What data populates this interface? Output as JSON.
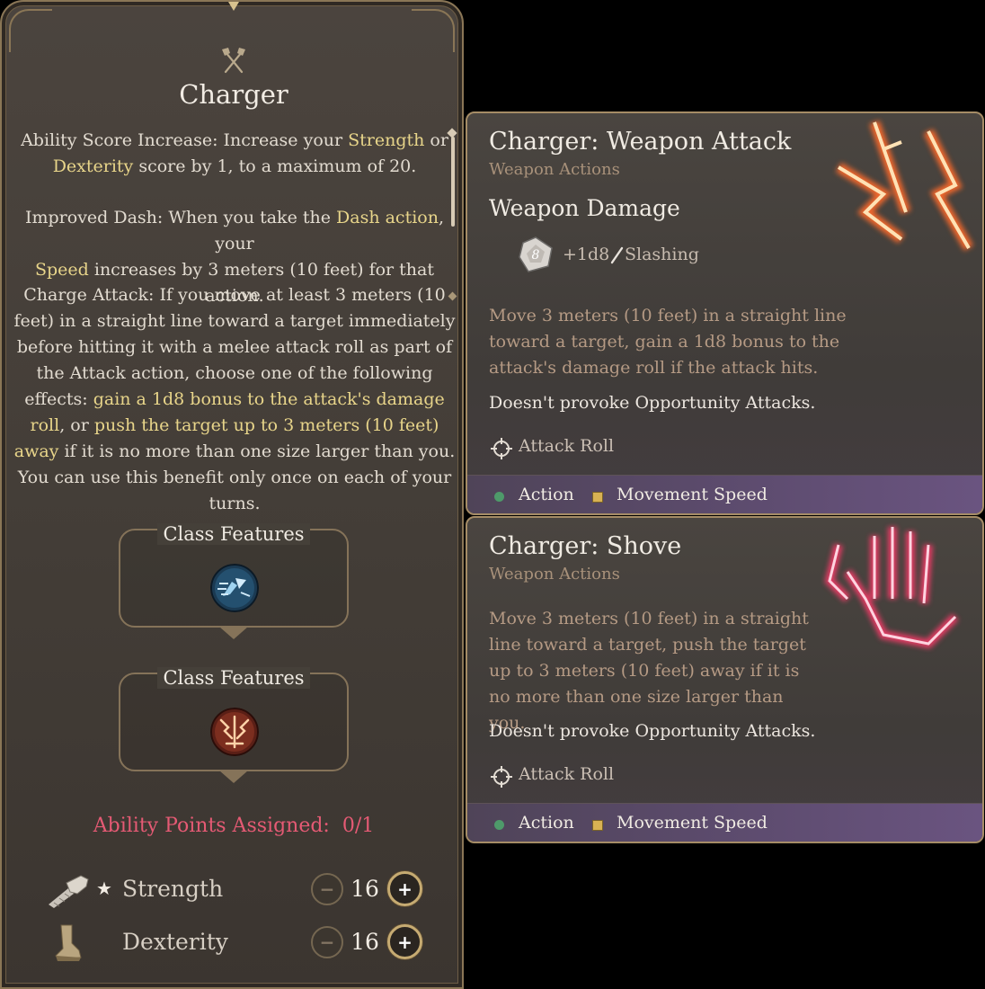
{
  "feat": {
    "icon": "crossed-axes-icon",
    "title": "Charger",
    "p1": {
      "t1": "Ability Score Increase: Increase your ",
      "h1": "Strength",
      "t2": " or",
      "h2": "Dexterity",
      "t3": " score by 1, to a maximum of 20."
    },
    "p2": {
      "t1": "Improved Dash: When you take the ",
      "h1": "Dash action",
      "t2": ", your",
      "h2": "Speed",
      "t3": " increases by 3 meters (10 feet) for that action."
    },
    "p3": {
      "t1": "Charge Attack: If you move at least 3 meters (10 feet) in a straight line toward a target immediately before hitting it with a melee attack roll as part of the Attack action, choose one of the following effects: ",
      "h1": "gain a 1d8 bonus to the attack's damage roll",
      "t2": ", or ",
      "h2": "push the target up to 3 meters (10 feet) away",
      "t3": " if it is no more than one size larger than you. You can use this benefit only once on each of your turns."
    },
    "class_features": [
      {
        "title": "Class Features",
        "icon": "charger-dash-icon"
      },
      {
        "title": "Class Features",
        "icon": "charger-burst-icon"
      }
    ],
    "ability_points_label": "Ability Points Assigned:",
    "ability_points_value": "0/1",
    "stats": [
      {
        "name": "Strength",
        "value": "16",
        "icon": "gauntlet-icon",
        "starred": true
      },
      {
        "name": "Dexterity",
        "value": "16",
        "icon": "boot-icon",
        "starred": false
      }
    ],
    "minus_symbol": "−",
    "plus_symbol": "+",
    "star_symbol": "★"
  },
  "tooltips": [
    {
      "title": "Charger: Weapon Attack",
      "subtitle": "Weapon Actions",
      "section": "Weapon Damage",
      "dice_label": "8",
      "damage_bonus": "+1d8",
      "damage_type": "Slashing",
      "description": "Move 3 meters (10 feet) in a straight line toward a target, gain a 1d8 bonus to the attack's damage roll if the attack hits.",
      "note": "Doesn't provoke Opportunity Attacks.",
      "roll": "Attack Roll",
      "footer": {
        "action": "Action",
        "resource": "Movement Speed"
      }
    },
    {
      "title": "Charger: Shove",
      "subtitle": "Weapon Actions",
      "description": "Move 3 meters (10 feet) in a straight line toward a target, push the target up to 3 meters (10 feet) away if it is no more than one size larger than you.",
      "note": "Doesn't provoke Opportunity Attacks.",
      "roll": "Attack Roll",
      "footer": {
        "action": "Action",
        "resource": "Movement Speed"
      }
    }
  ],
  "colors": {
    "highlight": "#e8d58a",
    "ability_points": "#e55a74",
    "tooltip_desc": "#b59a84",
    "action_dot": "#4e9a6a",
    "movement_square": "#d8b253"
  }
}
